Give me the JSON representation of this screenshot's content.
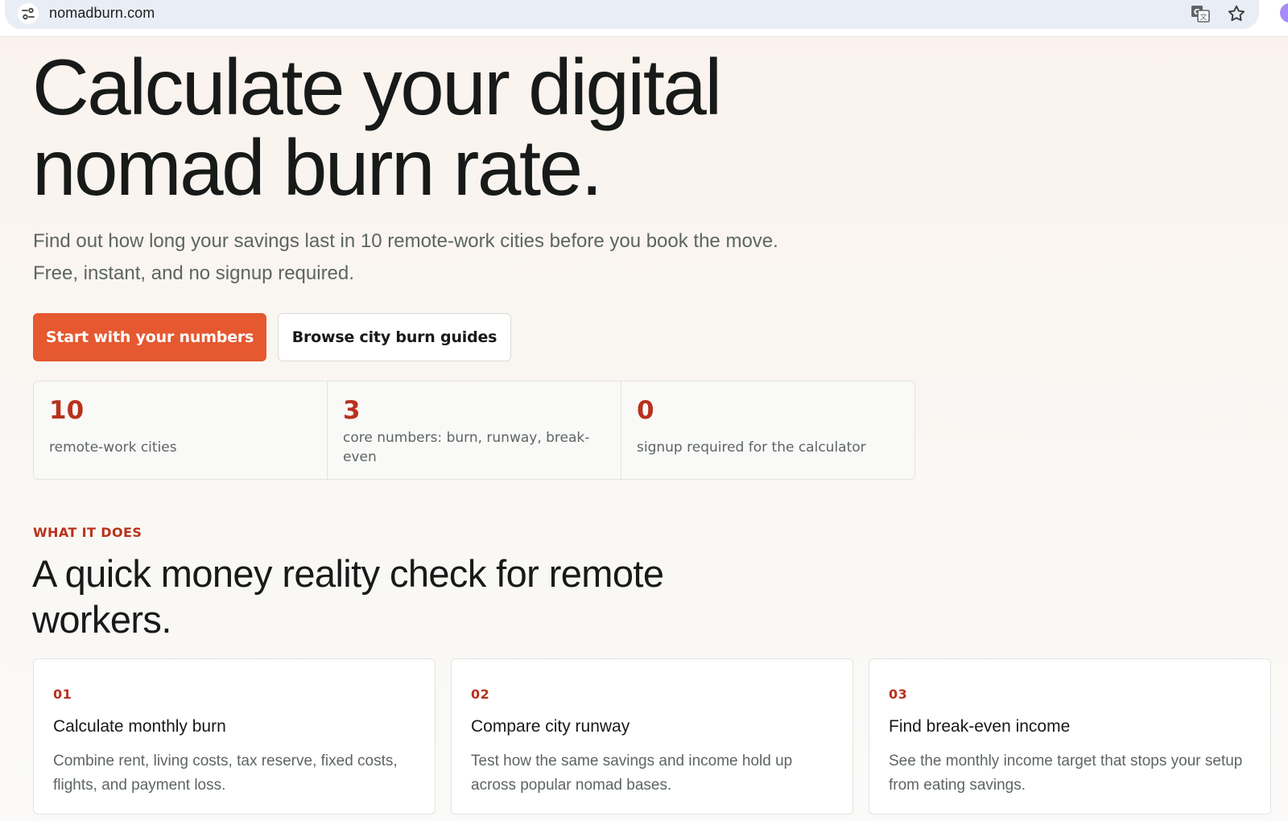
{
  "browser": {
    "url": "nomadburn.com",
    "icons": [
      "site-settings-icon",
      "translate-icon",
      "bookmark-star-icon",
      "profile-avatar"
    ]
  },
  "hero": {
    "title_line1": "Calculate your digital",
    "title_line2": "nomad burn rate.",
    "subtitle": "Find out how long your savings last in 10 remote-work cities before you book the move. Free, instant, and no signup required.",
    "primary_cta": "Start with your numbers",
    "secondary_cta": "Browse city burn guides"
  },
  "stats": [
    {
      "value": "10",
      "label": "remote-work cities"
    },
    {
      "value": "3",
      "label": "core numbers: burn, runway, break-even"
    },
    {
      "value": "0",
      "label": "signup required for the calculator"
    }
  ],
  "section": {
    "eyebrow": "WHAT IT DOES",
    "title": "A quick money reality check for remote workers."
  },
  "features": [
    {
      "num": "01",
      "title": "Calculate monthly burn",
      "desc": "Combine rent, living costs, tax reserve, fixed costs, flights, and payment loss."
    },
    {
      "num": "02",
      "title": "Compare city runway",
      "desc": "Test how the same savings and income hold up across popular nomad bases."
    },
    {
      "num": "03",
      "title": "Find break-even income",
      "desc": "See the monthly income target that stops your setup from eating savings."
    }
  ],
  "colors": {
    "accent": "#e55830",
    "accent_text": "#b8321d",
    "ink": "#171a19",
    "muted": "#5d6562"
  }
}
